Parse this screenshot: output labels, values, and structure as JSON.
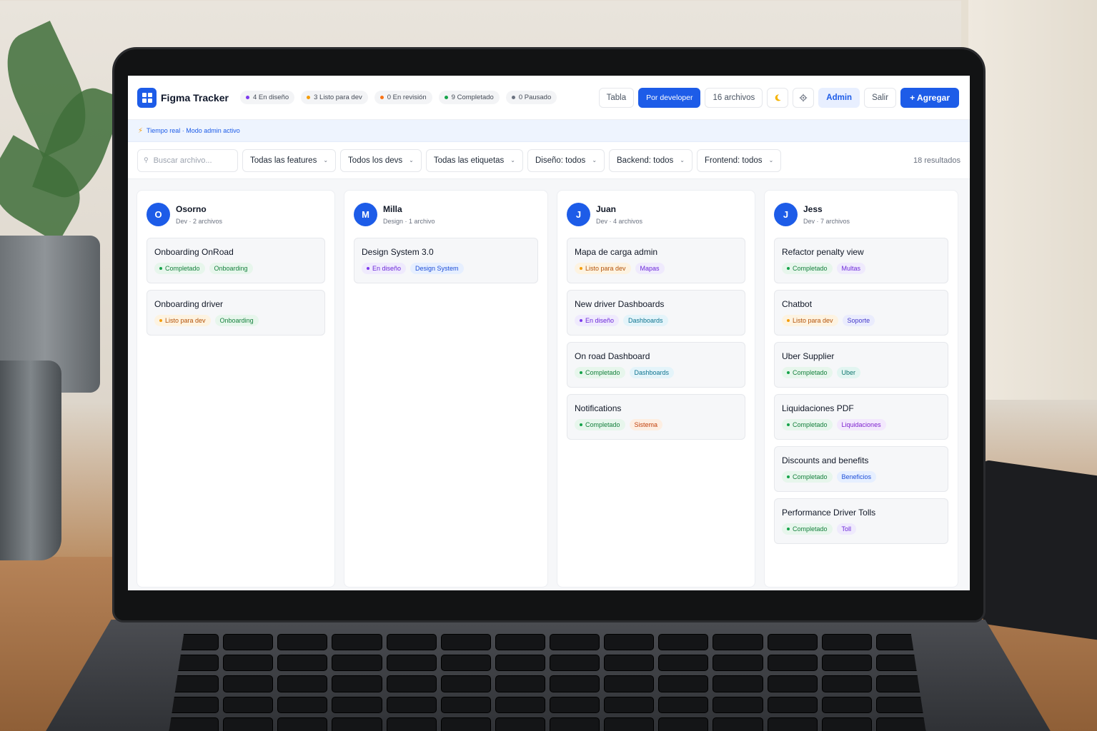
{
  "app": {
    "title": "Figma Tracker"
  },
  "stats": [
    {
      "label": "4 En diseño",
      "color": "#7c3aed"
    },
    {
      "label": "3 Listo para dev",
      "color": "#f59e0b"
    },
    {
      "label": "0 En revisión",
      "color": "#f97316"
    },
    {
      "label": "9 Completado",
      "color": "#16a34a"
    },
    {
      "label": "0 Pausado",
      "color": "#6b7280"
    }
  ],
  "toolbar": {
    "view_table": "Tabla",
    "view_developer": "Por developer",
    "files_count": "16 archivos",
    "theme_icon": "moon-icon",
    "settings_icon": "gear-icon",
    "admin": "Admin",
    "logout": "Salir",
    "add": "+ Agregar"
  },
  "banner": {
    "text": "Tiempo real · Modo admin activo",
    "icon": "bolt-icon"
  },
  "filters": {
    "search_placeholder": "Buscar archivo...",
    "features": "Todas las features",
    "devs": "Todos los devs",
    "labels": "Todas las etiquetas",
    "design": "Diseño: todos",
    "backend": "Backend: todos",
    "frontend": "Frontend: todos",
    "results": "18 resultados"
  },
  "colors": {
    "accent": "#1d5ce8",
    "status": {
      "Completado": {
        "fg": "#15803d",
        "bg": "#e7f6ec",
        "dot": "#16a34a"
      },
      "Listo para dev": {
        "fg": "#b45309",
        "bg": "#fdf3e1",
        "dot": "#f59e0b"
      },
      "En diseño": {
        "fg": "#6d28d9",
        "bg": "#efeafd",
        "dot": "#7c3aed"
      }
    }
  },
  "columns": [
    {
      "initial": "O",
      "name": "Osorno",
      "meta": "Dev · 2 archivos",
      "cards": [
        {
          "title": "Onboarding OnRoad",
          "status": "Completado",
          "tag": "Onboarding",
          "tag_fg": "#15803d",
          "tag_bg": "#e7f6ec"
        },
        {
          "title": "Onboarding driver",
          "status": "Listo para dev",
          "tag": "Onboarding",
          "tag_fg": "#15803d",
          "tag_bg": "#e7f6ec"
        }
      ]
    },
    {
      "initial": "M",
      "name": "Milla",
      "meta": "Design · 1 archivo",
      "cards": [
        {
          "title": "Design System 3.0",
          "status": "En diseño",
          "tag": "Design System",
          "tag_fg": "#1d4ed8",
          "tag_bg": "#e6efff"
        }
      ]
    },
    {
      "initial": "J",
      "name": "Juan",
      "meta": "Dev · 4 archivos",
      "cards": [
        {
          "title": "Mapa de carga admin",
          "status": "Listo para dev",
          "tag": "Mapas",
          "tag_fg": "#6d28d9",
          "tag_bg": "#efeafd"
        },
        {
          "title": "New driver Dashboards",
          "status": "En diseño",
          "tag": "Dashboards",
          "tag_fg": "#0e7490",
          "tag_bg": "#e4f4fa"
        },
        {
          "title": "On road Dashboard",
          "status": "Completado",
          "tag": "Dashboards",
          "tag_fg": "#0e7490",
          "tag_bg": "#e4f4fa"
        },
        {
          "title": "Notifications",
          "status": "Completado",
          "tag": "Sistema",
          "tag_fg": "#c2410c",
          "tag_bg": "#fdeee2"
        }
      ]
    },
    {
      "initial": "J",
      "name": "Jess",
      "meta": "Dev · 7 archivos",
      "cards": [
        {
          "title": "Refactor penalty view",
          "status": "Completado",
          "tag": "Multas",
          "tag_fg": "#6d28d9",
          "tag_bg": "#efeafd"
        },
        {
          "title": "Chatbot",
          "status": "Listo para dev",
          "tag": "Soporte",
          "tag_fg": "#4338ca",
          "tag_bg": "#eaecfd"
        },
        {
          "title": "Uber Supplier",
          "status": "Completado",
          "tag": "Uber",
          "tag_fg": "#0f766e",
          "tag_bg": "#e2f5f1"
        },
        {
          "title": "Liquidaciones PDF",
          "status": "Completado",
          "tag": "Liquidaciones",
          "tag_fg": "#7e22ce",
          "tag_bg": "#f3e8fd"
        },
        {
          "title": "Discounts and benefits",
          "status": "Completado",
          "tag": "Beneficios",
          "tag_fg": "#1d4ed8",
          "tag_bg": "#e6efff"
        },
        {
          "title": "Performance Driver Tolls",
          "status": "Completado",
          "tag": "Toll",
          "tag_fg": "#6d28d9",
          "tag_bg": "#efeafd"
        }
      ]
    }
  ]
}
